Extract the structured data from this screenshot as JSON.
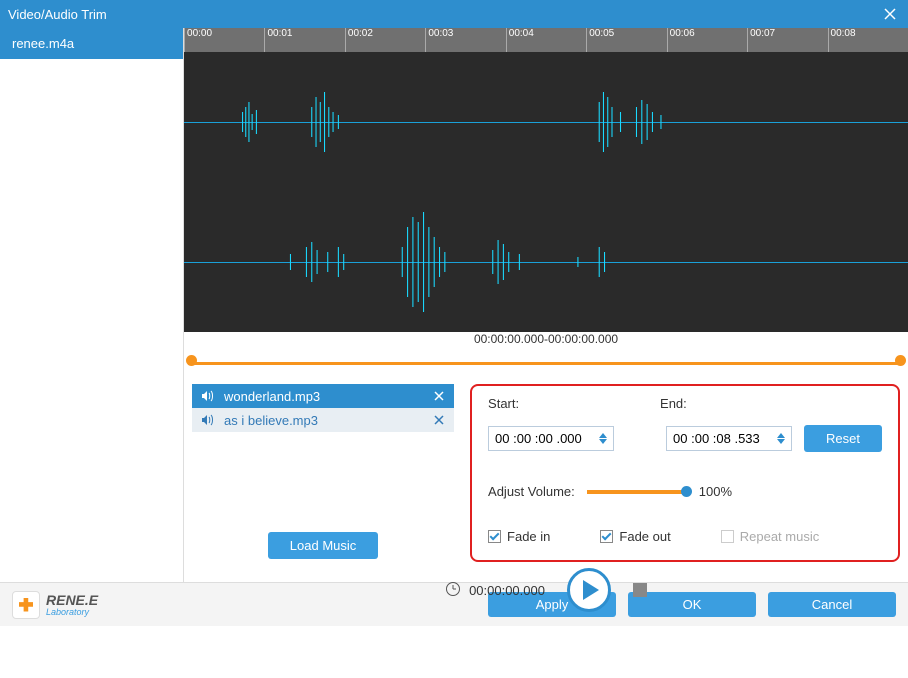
{
  "title": "Video/Audio Trim",
  "sidebar": {
    "items": [
      {
        "label": "renee.m4a"
      }
    ]
  },
  "ruler": [
    "00:00",
    "00:01",
    "00:02",
    "00:03",
    "00:04",
    "00:05",
    "00:06",
    "00:07",
    "00:08"
  ],
  "range": {
    "label": "00:00:00.000-00:00:00.000"
  },
  "music": {
    "items": [
      {
        "label": "wonderland.mp3",
        "active": true
      },
      {
        "label": "as i believe.mp3",
        "active": false
      }
    ],
    "load_label": "Load Music"
  },
  "controls": {
    "start_label": "Start:",
    "end_label": "End:",
    "start_value": "00 :00 :00 .000",
    "end_value": "00 :00 :08 .533",
    "reset_label": "Reset",
    "volume_label": "Adjust Volume:",
    "volume_value": "100%",
    "fade_in_label": "Fade in",
    "fade_out_label": "Fade out",
    "repeat_label": "Repeat music"
  },
  "playbar": {
    "time": "00:00:00.000"
  },
  "footer": {
    "brand_top": "RENE.E",
    "brand_sub": "Laboratory",
    "apply": "Apply",
    "ok": "OK",
    "cancel": "Cancel"
  }
}
